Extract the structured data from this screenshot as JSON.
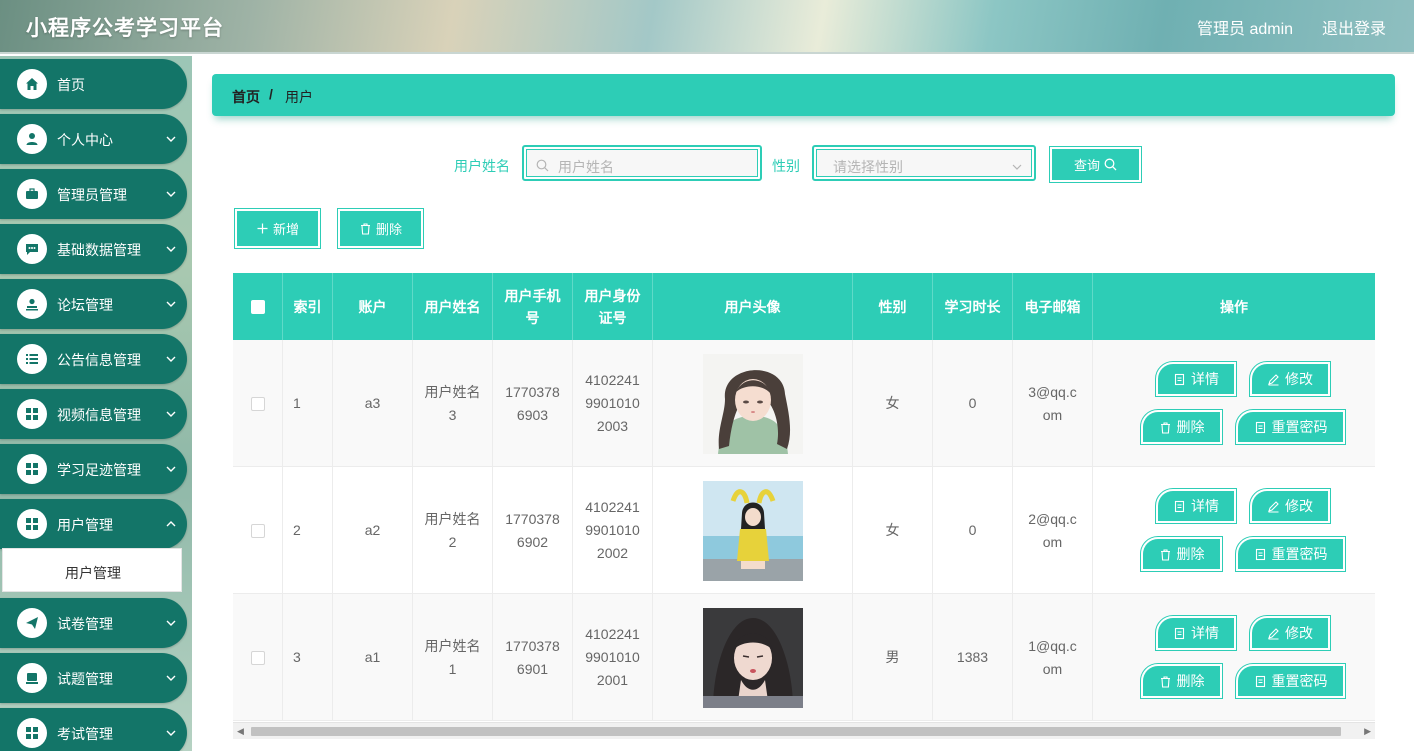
{
  "app": {
    "title": "小程序公考学习平台",
    "admin_label": "管理员 admin",
    "logout_label": "退出登录"
  },
  "colors": {
    "accent": "#2dcdb6",
    "sidebar_item": "#137568"
  },
  "sidebar": {
    "items": [
      {
        "label": "首页",
        "icon": "home-icon"
      },
      {
        "label": "个人中心",
        "icon": "user-icon"
      },
      {
        "label": "管理员管理",
        "icon": "briefcase-icon"
      },
      {
        "label": "基础数据管理",
        "icon": "chat-icon"
      },
      {
        "label": "论坛管理",
        "icon": "forum-icon"
      },
      {
        "label": "公告信息管理",
        "icon": "list-icon"
      },
      {
        "label": "视频信息管理",
        "icon": "grid-icon"
      },
      {
        "label": "学习足迹管理",
        "icon": "grid-icon"
      },
      {
        "label": "用户管理",
        "icon": "grid-icon"
      },
      {
        "label": "试卷管理",
        "icon": "send-icon"
      },
      {
        "label": "试题管理",
        "icon": "monitor-icon"
      },
      {
        "label": "考试管理",
        "icon": "grid-icon"
      }
    ],
    "submenu_label": "用户管理"
  },
  "breadcrumb": {
    "home": "首页",
    "separator": "/",
    "current": "用户"
  },
  "search": {
    "name_label": "用户姓名",
    "name_placeholder": "用户姓名",
    "gender_label": "性别",
    "gender_placeholder": "请选择性别",
    "query_label": "查询"
  },
  "actions": {
    "add_label": "新增",
    "delete_label": "删除"
  },
  "table": {
    "headers": [
      "",
      "索引",
      "账户",
      "用户姓名",
      "用户手机号",
      "用户身份证号",
      "用户头像",
      "性别",
      "学习时长",
      "电子邮箱",
      "操作"
    ],
    "op_labels": {
      "detail": "详情",
      "edit": "修改",
      "delete": "删除",
      "reset": "重置密码"
    },
    "rows": [
      {
        "index": "1",
        "account": "a3",
        "name": "用户姓名3",
        "phone": "17703786903",
        "idcard": "410224199010102003",
        "gender": "女",
        "duration": "0",
        "email": "3@qq.com"
      },
      {
        "index": "2",
        "account": "a2",
        "name": "用户姓名2",
        "phone": "17703786902",
        "idcard": "410224199010102002",
        "gender": "女",
        "duration": "0",
        "email": "2@qq.com"
      },
      {
        "index": "3",
        "account": "a1",
        "name": "用户姓名1",
        "phone": "17703786901",
        "idcard": "410224199010102001",
        "gender": "男",
        "duration": "1383",
        "email": "1@qq.com"
      }
    ]
  }
}
